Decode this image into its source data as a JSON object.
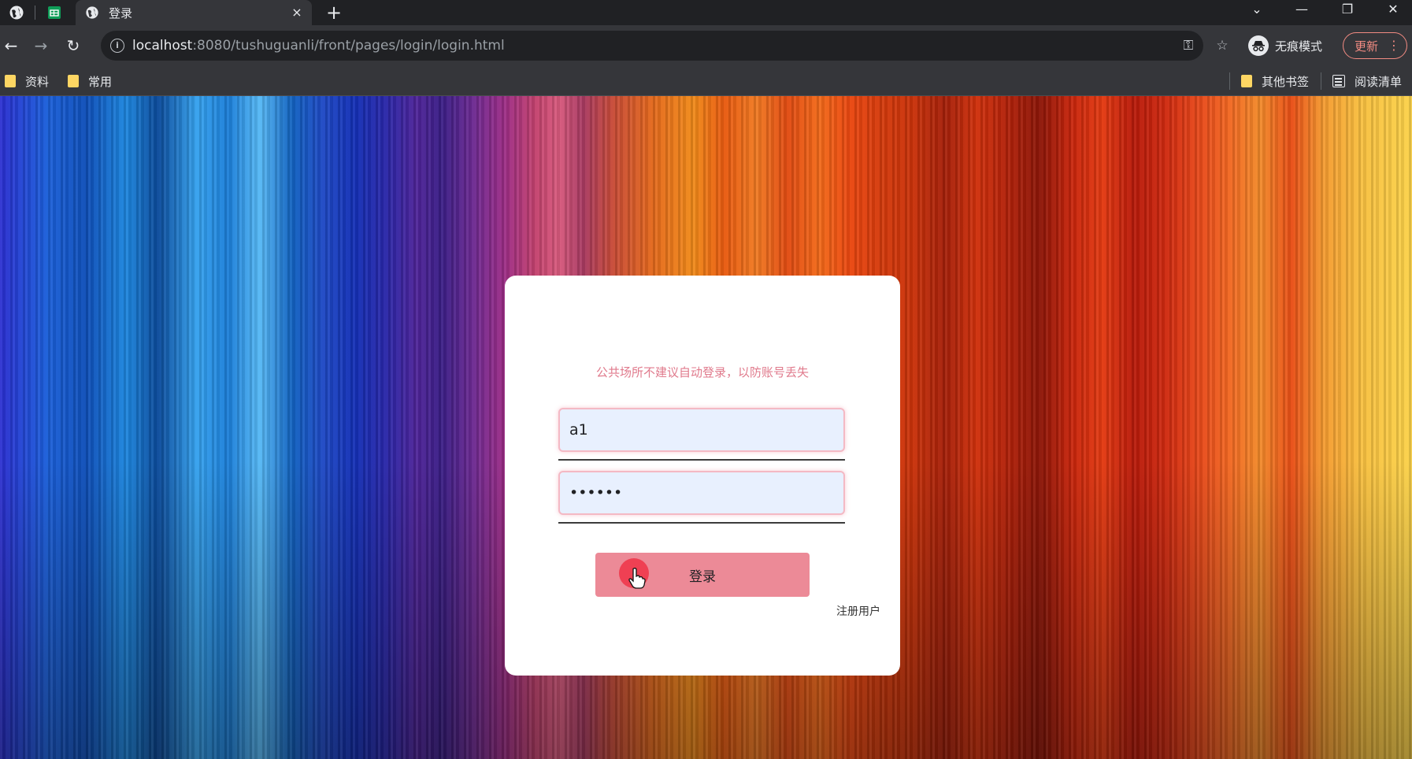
{
  "browser": {
    "tab": {
      "title": "登录",
      "close_label": "×"
    },
    "new_tab_label": "+",
    "url": {
      "host": "localhost",
      "path": ":8080/tushuguanli/front/pages/login/login.html"
    },
    "incognito_label": "无痕模式",
    "update_label": "更新",
    "bookmarks": [
      {
        "label": "资料"
      },
      {
        "label": "常用"
      }
    ],
    "other_bookmarks_label": "其他书签",
    "reading_list_label": "阅读清单"
  },
  "login": {
    "notice": "公共场所不建议自动登录，以防账号丢失",
    "username_value": "a1",
    "password_value": "••••••",
    "login_button_label": "登录",
    "register_link_label": "注册用户"
  },
  "colors": {
    "card_background": "#ffffff",
    "notice_text": "#e07a8c",
    "login_button": "#ec8a97",
    "input_background": "#e8f0fe"
  }
}
